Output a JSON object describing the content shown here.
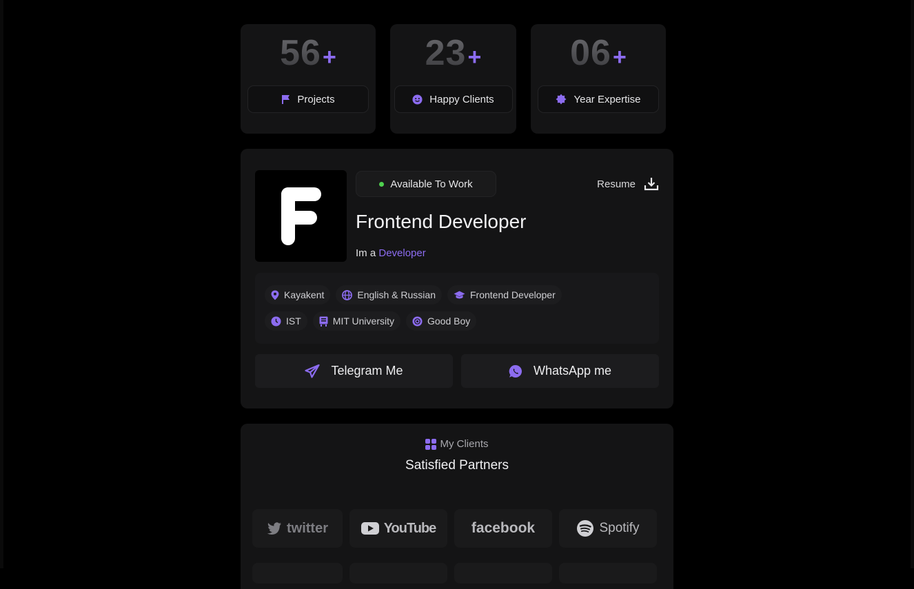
{
  "stats": [
    {
      "value": "56",
      "plus": "+",
      "label": "Projects",
      "icon": "flag-icon"
    },
    {
      "value": "23",
      "plus": "+",
      "label": "Happy Clients",
      "icon": "smile-icon"
    },
    {
      "value": "06",
      "plus": "+",
      "label": "Year Expertise",
      "icon": "award-icon"
    }
  ],
  "profile": {
    "logo_letter": "F",
    "status": "Available To Work",
    "resume_label": "Resume",
    "title": "Frontend Developer",
    "tagline_prefix": "Im a",
    "tagline_highlight": "Developer",
    "chips_row1": [
      {
        "label": "Kayakent",
        "icon": "location-pin-icon"
      },
      {
        "label": "English & Russian",
        "icon": "globe-icon"
      },
      {
        "label": "Frontend Developer",
        "icon": "graduation-cap-icon"
      }
    ],
    "chips_row2": [
      {
        "label": "IST",
        "icon": "clock-icon"
      },
      {
        "label": "MIT University",
        "icon": "school-icon"
      },
      {
        "label": "Good Boy",
        "icon": "badge-icon"
      }
    ],
    "buttons": [
      {
        "label": "Telegram Me",
        "icon": "telegram-icon"
      },
      {
        "label": "WhatsApp me",
        "icon": "whatsapp-icon"
      }
    ]
  },
  "clients": {
    "tag": "My Clients",
    "title": "Satisfied Partners",
    "logos": [
      {
        "name": "twitter",
        "icon": "twitter-icon"
      },
      {
        "name": "YouTube",
        "icon": "youtube-icon"
      },
      {
        "name": "facebook",
        "icon": ""
      },
      {
        "name": "Spotify",
        "icon": "spotify-icon"
      }
    ]
  },
  "colors": {
    "accent": "#8c6cf0",
    "status_green": "#4fd14f",
    "card": "#141415",
    "background": "#000000"
  }
}
